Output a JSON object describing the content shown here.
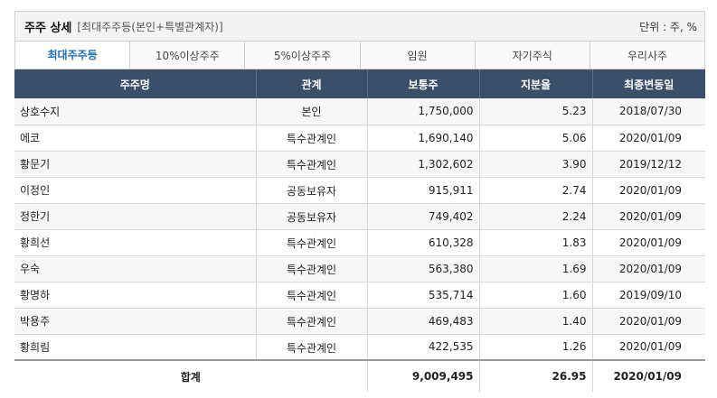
{
  "header": {
    "title": "주주 상세",
    "subtitle": "[최대주주등(본인+특별관계자)]",
    "unit": "단위 : 주, %"
  },
  "tabs": [
    {
      "label": "최대주주등",
      "active": true
    },
    {
      "label": "10%이상주주",
      "active": false
    },
    {
      "label": "5%이상주주",
      "active": false
    },
    {
      "label": "임원",
      "active": false
    },
    {
      "label": "자기주식",
      "active": false
    },
    {
      "label": "우리사주",
      "active": false
    }
  ],
  "table": {
    "columns": [
      "주주명",
      "관계",
      "보통주",
      "지분율",
      "최종변동일"
    ],
    "rows": [
      {
        "name": "상호수지",
        "relation": "본인",
        "shares": "1,750,000",
        "ratio": "5.23",
        "date": "2018/07/30"
      },
      {
        "name": "에코",
        "relation": "특수관계인",
        "shares": "1,690,140",
        "ratio": "5.06",
        "date": "2020/01/09"
      },
      {
        "name": "황문기",
        "relation": "특수관계인",
        "shares": "1,302,602",
        "ratio": "3.90",
        "date": "2019/12/12"
      },
      {
        "name": "이정인",
        "relation": "공동보유자",
        "shares": "915,911",
        "ratio": "2.74",
        "date": "2020/01/09"
      },
      {
        "name": "정한기",
        "relation": "공동보유자",
        "shares": "749,402",
        "ratio": "2.24",
        "date": "2020/01/09"
      },
      {
        "name": "황희선",
        "relation": "특수관계인",
        "shares": "610,328",
        "ratio": "1.83",
        "date": "2020/01/09"
      },
      {
        "name": "우숙",
        "relation": "특수관계인",
        "shares": "563,380",
        "ratio": "1.69",
        "date": "2020/01/09"
      },
      {
        "name": "황명하",
        "relation": "특수관계인",
        "shares": "535,714",
        "ratio": "1.60",
        "date": "2019/09/10"
      },
      {
        "name": "박용주",
        "relation": "특수관계인",
        "shares": "469,483",
        "ratio": "1.40",
        "date": "2020/01/09"
      },
      {
        "name": "황희림",
        "relation": "특수관계인",
        "shares": "422,535",
        "ratio": "1.26",
        "date": "2020/01/09"
      }
    ],
    "total": {
      "label": "합계",
      "shares": "9,009,495",
      "ratio": "26.95",
      "date": "2020/01/09"
    }
  }
}
